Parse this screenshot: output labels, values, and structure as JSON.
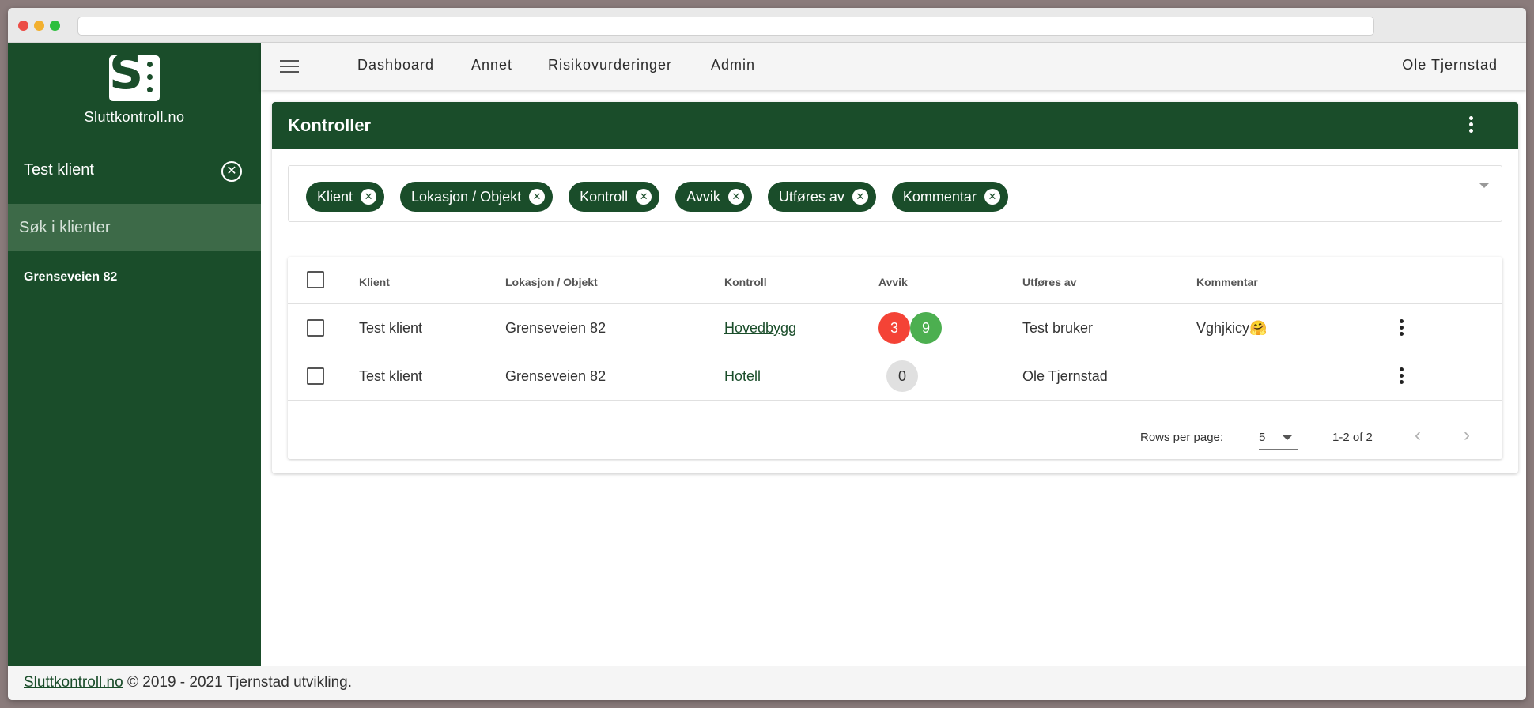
{
  "app": {
    "brand": "Sluttkontroll.no"
  },
  "sidebar": {
    "selected_client": "Test klient",
    "search_placeholder": "Søk i klienter",
    "items": [
      {
        "label": "Grenseveien 82"
      }
    ]
  },
  "nav": {
    "links": [
      {
        "label": "Dashboard"
      },
      {
        "label": "Annet"
      },
      {
        "label": "Risikovurderinger"
      },
      {
        "label": "Admin"
      }
    ],
    "user": "Ole Tjernstad"
  },
  "card": {
    "title": "Kontroller",
    "filter_chips": [
      {
        "label": "Klient"
      },
      {
        "label": "Lokasjon / Objekt"
      },
      {
        "label": "Kontroll"
      },
      {
        "label": "Avvik"
      },
      {
        "label": "Utføres av"
      },
      {
        "label": "Kommentar"
      }
    ],
    "table": {
      "columns": [
        "Klient",
        "Lokasjon / Objekt",
        "Kontroll",
        "Avvik",
        "Utføres av",
        "Kommentar"
      ],
      "rows": [
        {
          "klient": "Test klient",
          "lokasjon": "Grenseveien 82",
          "kontroll": "Hovedbygg",
          "avvik_open": "3",
          "avvik_closed": "9",
          "utfores_av": "Test bruker",
          "kommentar": "Vghjkicy🤗"
        },
        {
          "klient": "Test klient",
          "lokasjon": "Grenseveien 82",
          "kontroll": "Hotell",
          "avvik_total": "0",
          "utfores_av": "Ole Tjernstad",
          "kommentar": ""
        }
      ]
    },
    "pagination": {
      "rows_per_page_label": "Rows per page:",
      "rows_per_page": "5",
      "range": "1-2 of 2"
    }
  },
  "footer": {
    "link": "Sluttkontroll.no",
    "text": "© 2019 - 2021 Tjernstad utvikling."
  },
  "colors": {
    "primary": "#1a4d2a",
    "badge_red": "#f44336",
    "badge_green": "#4caf50",
    "badge_grey": "#e0e0e0"
  }
}
